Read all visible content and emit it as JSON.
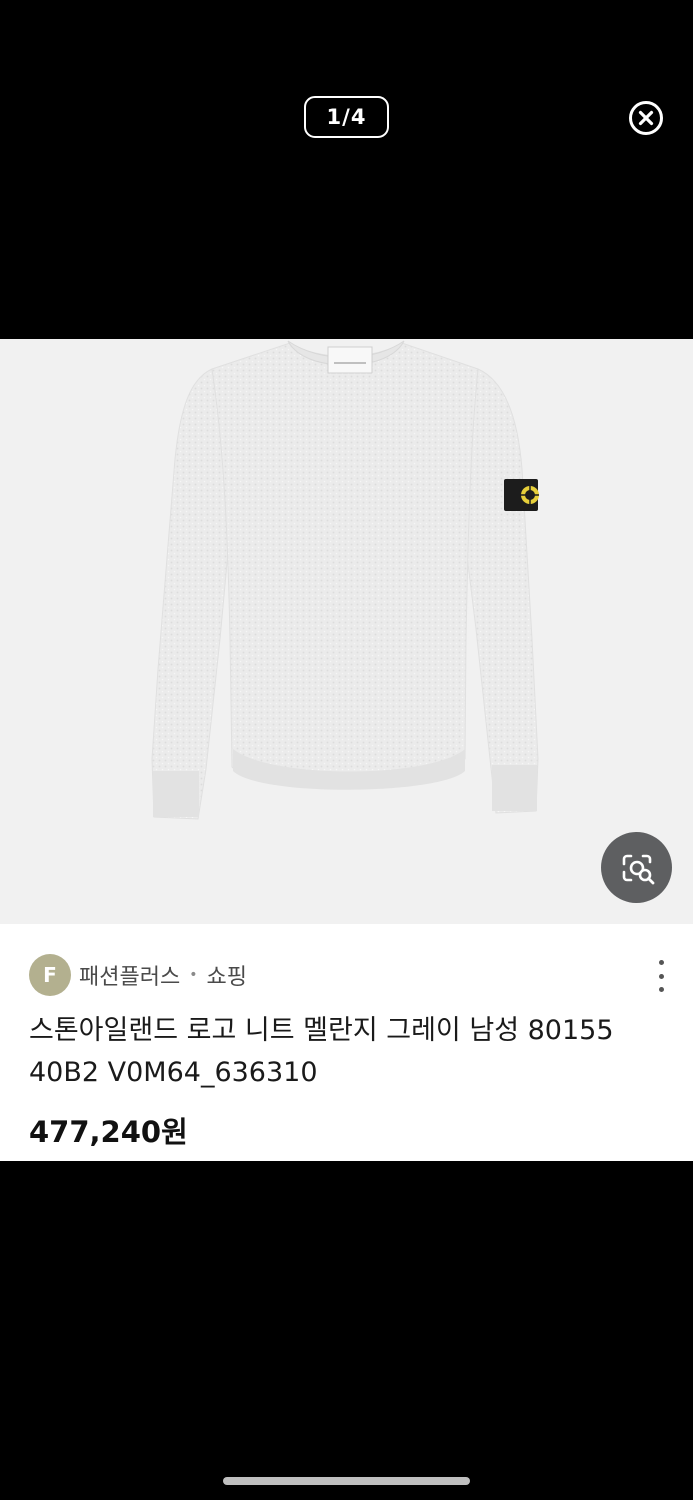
{
  "viewer": {
    "counter": "1/4"
  },
  "product_image": {
    "alt": "Stone Island gray crewneck knit sweater with compass badge"
  },
  "source": {
    "avatar_letter": "F",
    "avatar_color": "#b3b08f",
    "name": "패션플러스",
    "separator": "•",
    "type": "쇼핑"
  },
  "product": {
    "title": "스톤아일랜드 로고 니트 멜란지 그레이 남성 80155 40B2 V0M64_636310",
    "price": "477,240원"
  },
  "icons": {
    "close": "close-circle-icon",
    "lens": "visual-search-icon",
    "more": "more-vertical-icon"
  }
}
